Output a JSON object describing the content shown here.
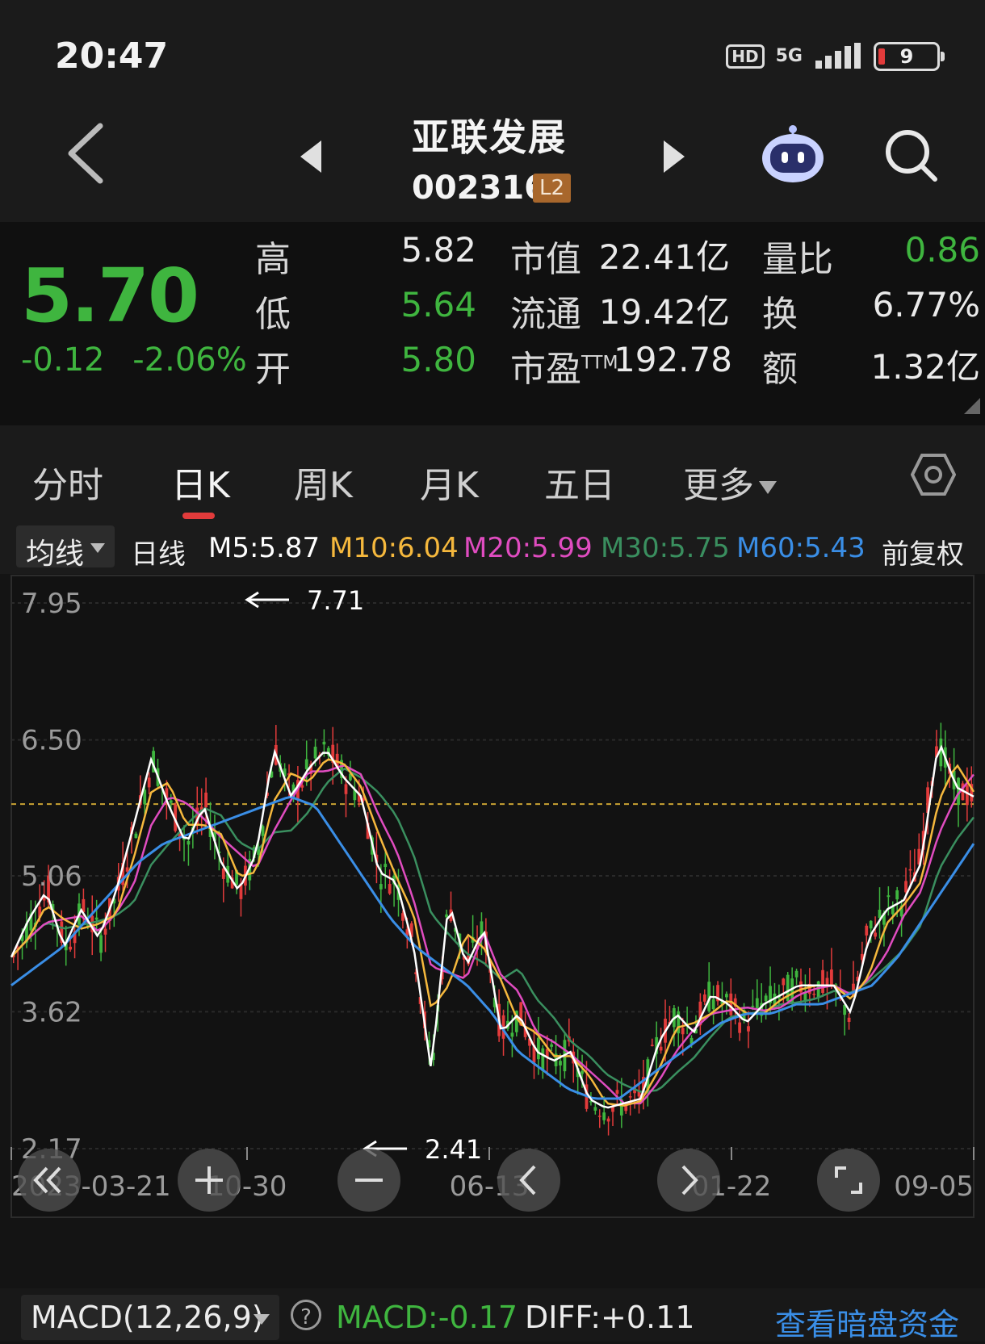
{
  "status_bar": {
    "time": "20:47",
    "hd": "HD",
    "network": "5G",
    "battery": "9"
  },
  "header": {
    "stock_name": "亚联发展",
    "stock_code": "002316",
    "level_badge": "L2"
  },
  "quote": {
    "price": "5.70",
    "change": "-0.12",
    "change_pct": "-2.06%",
    "high_label": "高",
    "high": "5.82",
    "low_label": "低",
    "low": "5.64",
    "open_label": "开",
    "open": "5.80",
    "mcap_label": "市值",
    "mcap": "22.41亿",
    "float_label": "流通",
    "float": "19.42亿",
    "pe_label": "市盈",
    "pe_sup": "TTM",
    "pe": "192.78",
    "vol_ratio_label": "量比",
    "vol_ratio": "0.86",
    "turnover_label": "换",
    "turnover": "6.77%",
    "amount_label": "额",
    "amount": "1.32亿"
  },
  "tabs": {
    "t1": "分时",
    "t2": "日K",
    "t3": "周K",
    "t4": "月K",
    "t5": "五日",
    "t6": "更多",
    "active": "日K"
  },
  "ma": {
    "select": "均线",
    "period": "日线",
    "m5": "M5:5.87",
    "m10": "M10:6.04",
    "m20": "M20:5.99",
    "m30": "M30:5.75",
    "m60": "M60:5.43",
    "adjust": "前复权"
  },
  "colors": {
    "up": "#e23b3b",
    "down": "#3fb53f",
    "m5": "#ffffff",
    "m10": "#f5b83d",
    "m20": "#e04cc0",
    "m30": "#3a8f5f",
    "m60": "#3a8ee6"
  },
  "chart_data": {
    "type": "candlestick",
    "y_ticks": [
      "7.95",
      "6.50",
      "5.06",
      "3.62",
      "2.17"
    ],
    "ylim": [
      2.17,
      7.95
    ],
    "x_ticks": [
      "2023-03-21",
      "10-30",
      "06-13",
      "01-22",
      "09-05"
    ],
    "max_marker": "7.71",
    "min_marker": "2.41",
    "reference_price": 5.82,
    "series_m5": [
      4.2,
      4.6,
      4.9,
      4.3,
      4.7,
      4.4,
      4.9,
      5.6,
      6.3,
      5.8,
      5.4,
      5.8,
      5.2,
      4.9,
      5.3,
      6.4,
      5.9,
      6.2,
      6.4,
      6.1,
      5.9,
      5.1,
      5.0,
      4.3,
      3.0,
      4.8,
      4.1,
      4.5,
      3.4,
      3.6,
      3.2,
      3.1,
      3.2,
      2.7,
      2.6,
      2.65,
      2.7,
      3.3,
      3.6,
      3.4,
      3.8,
      3.7,
      3.5,
      3.7,
      3.8,
      3.9,
      3.9,
      3.9,
      3.6,
      4.4,
      4.7,
      4.8,
      5.2,
      6.5,
      6.0,
      5.9
    ],
    "series_m60": [
      3.9,
      4.1,
      4.3,
      4.6,
      4.9,
      5.2,
      5.4,
      5.5,
      5.6,
      5.7,
      5.8,
      5.9,
      5.8,
      5.4,
      5.0,
      4.6,
      4.3,
      4.1,
      3.9,
      3.6,
      3.2,
      3.0,
      2.8,
      2.7,
      2.7,
      2.9,
      3.1,
      3.3,
      3.5,
      3.6,
      3.6,
      3.7,
      3.7,
      3.8,
      3.9,
      4.2,
      4.6,
      5.0,
      5.4
    ]
  },
  "controls": {
    "fast_back": "fast-back",
    "zoom_in": "zoom-in",
    "zoom_out": "zoom-out",
    "prev": "prev",
    "next": "next",
    "fullscreen": "fullscreen"
  },
  "macd": {
    "select": "MACD(12,26,9)",
    "help": "?",
    "macd_value": "MACD:-0.17",
    "diff_value": "DIFF:+0.11",
    "dark_pool_link": "查看暗盘资金"
  }
}
